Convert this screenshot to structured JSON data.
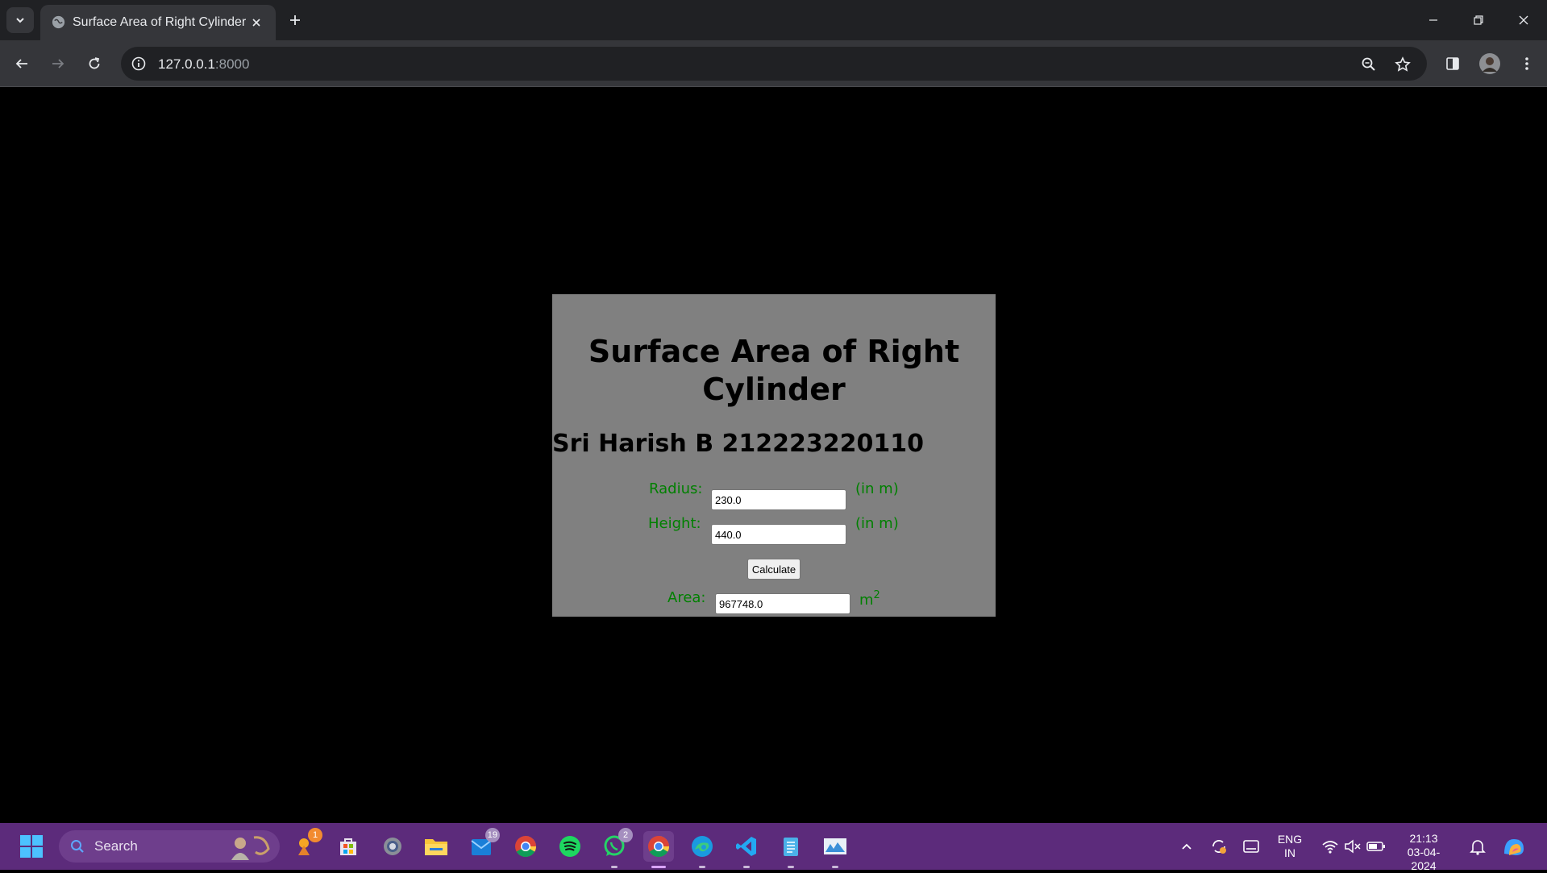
{
  "browser": {
    "tab_title": "Surface Area of Right Cylinder",
    "url_host": "127.0.0.1",
    "url_port": ":8000"
  },
  "page": {
    "title": "Surface Area of Right Cylinder",
    "author": "Sri Harish B 212223220110",
    "radius_label": "Radius:",
    "radius_value": "230.0",
    "radius_unit": "(in m)",
    "height_label": "Height:",
    "height_value": "440.0",
    "height_unit": "(in m)",
    "calculate_label": "Calculate",
    "area_label": "Area:",
    "area_value": "967748.0",
    "area_unit": "m",
    "area_unit_exponent": "2"
  },
  "taskbar": {
    "search_label": "Search",
    "widgets_badge": "1",
    "outlook_badge": "19",
    "whatsapp_badge": "2",
    "language_line1": "ENG",
    "language_line2": "IN",
    "time": "21:13",
    "date": "03-04-2024"
  },
  "colors": {
    "card_bg": "#808080",
    "label_green": "#008000",
    "taskbar_bg": "#5c2b7b"
  }
}
